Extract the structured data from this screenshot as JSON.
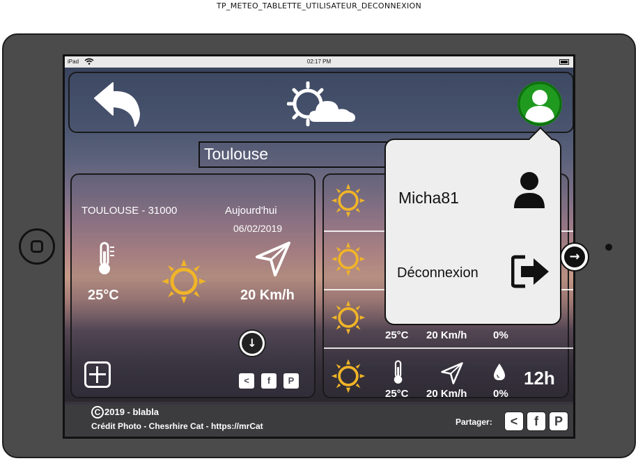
{
  "caption": "TP_METEO_TABLETTE_UTILISATEUR_DECONNEXION",
  "status_bar": {
    "carrier": "iPad",
    "time": "02:17 PM"
  },
  "search": {
    "city": "Toulouse"
  },
  "current": {
    "location": "TOULOUSE - 31000",
    "day_label": "Aujourd'hui",
    "date": "06/02/2019",
    "temperature": "25°C",
    "wind": "20 Km/h"
  },
  "forecast": [
    {
      "temperature": "",
      "wind": "",
      "humidity": "",
      "hour": ""
    },
    {
      "temperature": "",
      "wind": "",
      "humidity": "",
      "hour": ""
    },
    {
      "temperature": "25°C",
      "wind": "20 Km/h",
      "humidity": "0%",
      "hour": ""
    },
    {
      "temperature": "25°C",
      "wind": "20 Km/h",
      "humidity": "0%",
      "hour": "12h"
    }
  ],
  "user_menu": {
    "username": "Micha81",
    "logout_label": "Déconnexion"
  },
  "footer": {
    "copyright": "2019 - blabla",
    "photo_credit": "Crédit Photo - Chesrhire Cat - https://mrCat",
    "share_label": "Partager:"
  },
  "icons": {
    "back": "back-arrow-icon",
    "logo": "sun-cloud-icon",
    "user": "user-circle-icon",
    "add": "add-square-icon",
    "share": "share-icon",
    "facebook": "facebook-icon",
    "pinterest": "pinterest-icon"
  },
  "colors": {
    "user_accent": "#1f9a1f",
    "sun": "#f0b428",
    "popover_bg": "#eeeeee",
    "footer_bg": "#3c3c3f"
  }
}
